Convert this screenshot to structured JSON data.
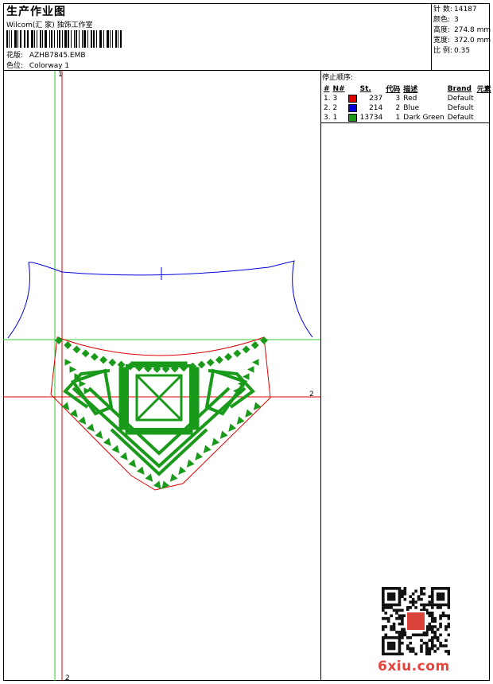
{
  "header": {
    "title": "生产作业图",
    "subtitle": "Wilcom(汇 家) 独饰工作室",
    "design_label": "花版:",
    "design_value": "AZHB7845.EMB",
    "colorway_label": "色位:",
    "colorway_value": "Colorway 1"
  },
  "stats": [
    {
      "label": "针 数:",
      "value": "14187"
    },
    {
      "label": "颜色:",
      "value": "3"
    },
    {
      "label": "高度:",
      "value": "274.8 mm"
    },
    {
      "label": "宽度:",
      "value": "372.0 mm"
    },
    {
      "label": "比 例:",
      "value": "0.35"
    }
  ],
  "stop_sequence": {
    "title": "停止顺序:",
    "headers": [
      "#",
      "N#",
      "St.",
      "代码",
      "描述",
      "Brand",
      "元素"
    ],
    "rows": [
      {
        "idx": "1. 3",
        "color": "#e00000",
        "stitches": "237",
        "code": "3",
        "desc": "Red",
        "brand": "Default"
      },
      {
        "idx": "2. 2",
        "color": "#0000e0",
        "stitches": "214",
        "code": "2",
        "desc": "Blue",
        "brand": "Default"
      },
      {
        "idx": "3. 1",
        "color": "#1a9a1a",
        "stitches": "13734",
        "code": "1",
        "desc": "Dark Green",
        "brand": "Default"
      }
    ]
  },
  "canvas": {
    "axis_labels": {
      "top_v": "1",
      "right_h": "2",
      "bottom_v": "2"
    },
    "colors": {
      "green": "#1a9a1a",
      "red": "#e00000",
      "blue": "#0000e0",
      "guide_green": "#33cc33"
    }
  },
  "watermark": "6xiu.com"
}
